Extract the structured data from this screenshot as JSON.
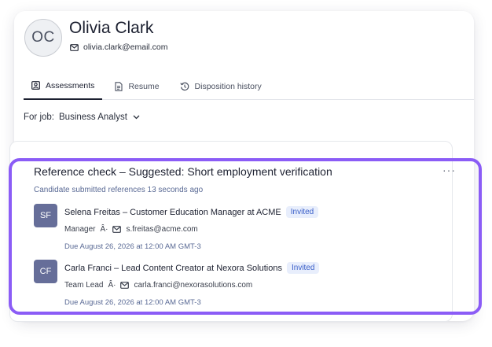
{
  "profile": {
    "initials": "OC",
    "name": "Olivia Clark",
    "email": "olivia.clark@email.com"
  },
  "tabs": [
    {
      "label": "Assessments",
      "icon": "portrait-icon",
      "active": true
    },
    {
      "label": "Resume",
      "icon": "document-icon",
      "active": false
    },
    {
      "label": "Disposition history",
      "icon": "history-icon",
      "active": false
    }
  ],
  "job_filter": {
    "label": "For job:",
    "value": "Business Analyst"
  },
  "reference_check": {
    "title": "Reference check – Suggested: Short employment verification",
    "more_label": "···",
    "submitted": "Candidate submitted references 13 seconds ago",
    "references": [
      {
        "initials": "SF",
        "name": "Selena Freitas – Customer Education Manager at ACME",
        "status": "Invited",
        "relation": "Manager",
        "separator": "Â·",
        "email": "s.freitas@acme.com",
        "due": "Due August 26, 2026 at 12:00 AM GMT-3"
      },
      {
        "initials": "CF",
        "name": "Carla Franci – Lead Content Creator at Nexora Solutions",
        "status": "Invited",
        "relation": "Team Lead",
        "separator": "Â·",
        "email": "carla.franci@nexorasolutions.com",
        "due": "Due August 26, 2026 at 12:00 AM GMT-3"
      }
    ]
  },
  "colors": {
    "highlight": "#8b5cf6",
    "avatar": "#666e99",
    "badge_bg": "#e8eefc",
    "badge_text": "#3a5fc8",
    "muted_link": "#5a6a95"
  }
}
